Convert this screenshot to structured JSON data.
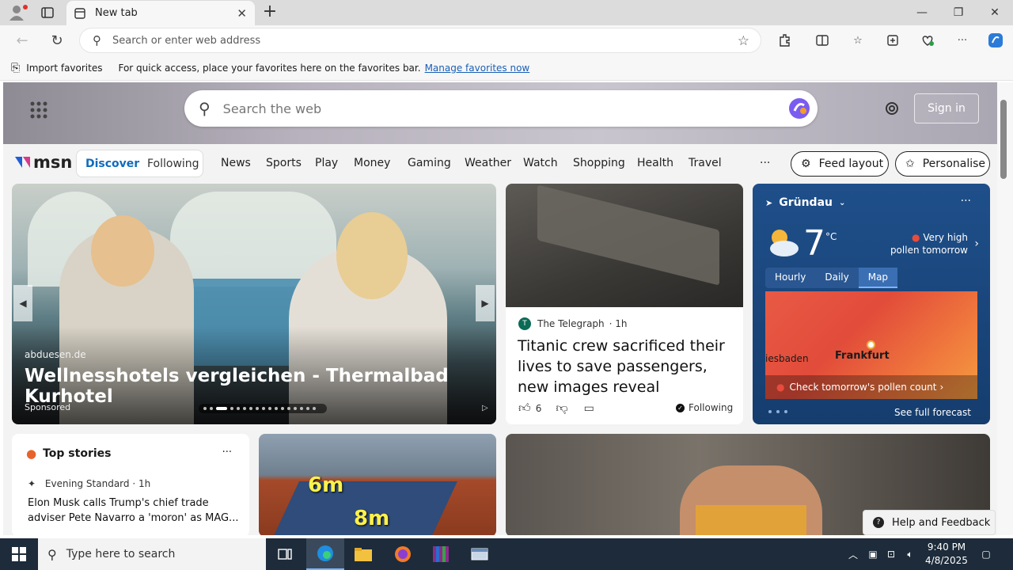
{
  "browser": {
    "tab_title": "New tab",
    "address_placeholder": "Search or enter web address"
  },
  "favbar": {
    "import_label": "Import favorites",
    "hint": "For quick access, place your favorites here on the favorites bar.",
    "manage_link": "Manage favorites now"
  },
  "msn": {
    "logo": "msn",
    "search_placeholder": "Search the web",
    "signin": "Sign in",
    "feed_tabs": [
      "Discover",
      "Following"
    ],
    "nav_links": [
      "News",
      "Sports",
      "Play",
      "Money",
      "Gaming",
      "Weather",
      "Watch",
      "Shopping",
      "Health",
      "Travel"
    ],
    "more": "···",
    "feed_layout": "Feed layout",
    "personalise": "Personalise"
  },
  "hero": {
    "source": "abduesen.de",
    "headline": "Wellnesshotels vergleichen - Thermalbad Kurhotel",
    "sponsored": "Sponsored"
  },
  "story2": {
    "publisher": "The Telegraph",
    "age": "· 1h",
    "title": "Titanic crew sacrificed their lives to save passengers, new images reveal",
    "likes": "6",
    "following": "Following"
  },
  "weather": {
    "location": "Gründau",
    "temp": "7",
    "unit": "°C",
    "pollen_line1": "Very high",
    "pollen_line2": "pollen tomorrow",
    "tabs": [
      "Hourly",
      "Daily",
      "Map"
    ],
    "city_left": "iesbaden",
    "city_main": "Frankfurt",
    "map_banner": "Check tomorrow's pollen count",
    "see_forecast": "See full forecast"
  },
  "top_stories": {
    "heading": "Top stories",
    "source": "Evening Standard · 1h",
    "title": "Elon Musk calls Trump's chief trade adviser Pete Navarro a 'moron' as MAG..."
  },
  "solar": {
    "label_a": "6m",
    "label_b": "8m"
  },
  "help": {
    "label": "Help and Feedback"
  },
  "taskbar": {
    "search_placeholder": "Type here to search",
    "time": "9:40 PM",
    "date": "4/8/2025"
  }
}
